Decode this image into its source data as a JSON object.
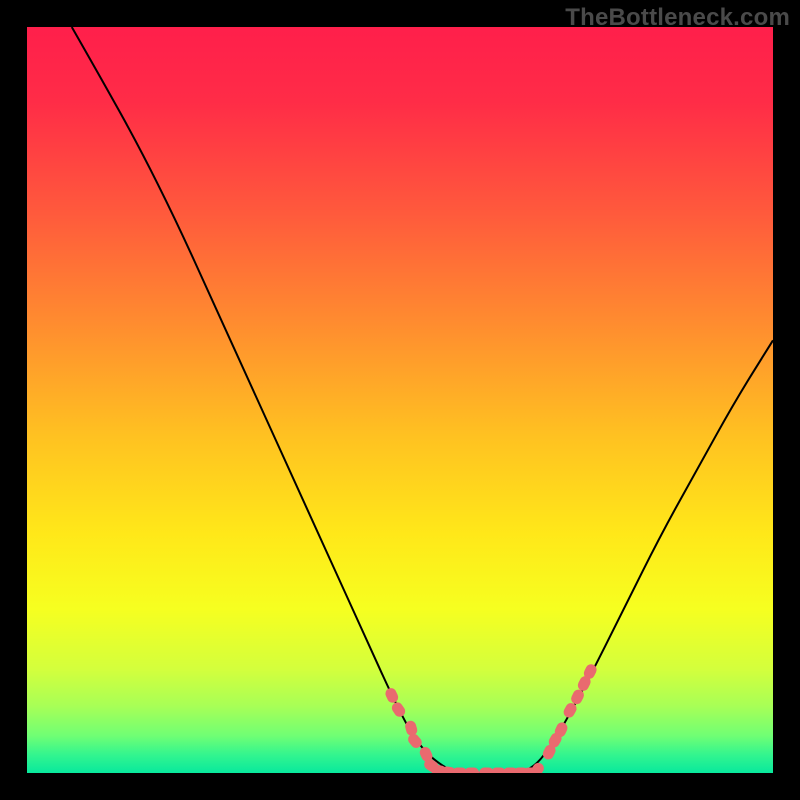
{
  "watermark": "TheBottleneck.com",
  "chart_data": {
    "type": "line",
    "title": "",
    "xlabel": "",
    "ylabel": "",
    "xlim": [
      0,
      100
    ],
    "ylim": [
      0,
      100
    ],
    "curve": {
      "name": "bottleneck-curve",
      "x": [
        6,
        10,
        15,
        20,
        25,
        30,
        35,
        40,
        45,
        50,
        53,
        57,
        60,
        63,
        67,
        70,
        75,
        80,
        85,
        90,
        95,
        100
      ],
      "y": [
        100,
        93,
        84,
        74,
        63,
        52,
        41,
        30,
        19,
        8,
        3,
        0,
        0,
        0,
        0,
        3,
        12,
        22,
        32,
        41,
        50,
        58
      ]
    },
    "marker_groups": [
      {
        "name": "left-cluster",
        "color": "#e96a6f",
        "points": [
          [
            48.9,
            10.4
          ],
          [
            49.8,
            8.5
          ],
          [
            51.5,
            6.0
          ],
          [
            52.0,
            4.3
          ],
          [
            53.5,
            2.5
          ],
          [
            54.2,
            1.0
          ],
          [
            55.2,
            0.3
          ],
          [
            56.5,
            0.1
          ]
        ]
      },
      {
        "name": "floor-cluster",
        "color": "#e96a6f",
        "points": [
          [
            56.5,
            0.0
          ],
          [
            58.0,
            0.0
          ],
          [
            59.6,
            0.0
          ],
          [
            61.6,
            0.0
          ],
          [
            63.2,
            0.0
          ],
          [
            64.8,
            0.0
          ],
          [
            66.2,
            0.0
          ],
          [
            67.5,
            0.0
          ]
        ]
      },
      {
        "name": "right-cluster",
        "color": "#e96a6f",
        "points": [
          [
            68.4,
            0.4
          ],
          [
            70.0,
            2.8
          ],
          [
            70.8,
            4.4
          ],
          [
            71.6,
            5.8
          ],
          [
            72.8,
            8.4
          ],
          [
            73.8,
            10.2
          ],
          [
            74.7,
            12.0
          ],
          [
            75.5,
            13.6
          ]
        ]
      }
    ],
    "gradient": {
      "stops": [
        {
          "offset": 0.0,
          "color": "#ff1f4b"
        },
        {
          "offset": 0.1,
          "color": "#ff2c47"
        },
        {
          "offset": 0.25,
          "color": "#ff5a3c"
        },
        {
          "offset": 0.4,
          "color": "#ff8d2f"
        },
        {
          "offset": 0.55,
          "color": "#ffc221"
        },
        {
          "offset": 0.68,
          "color": "#ffe819"
        },
        {
          "offset": 0.78,
          "color": "#f6ff20"
        },
        {
          "offset": 0.86,
          "color": "#d4ff3c"
        },
        {
          "offset": 0.91,
          "color": "#a8ff56"
        },
        {
          "offset": 0.95,
          "color": "#70ff74"
        },
        {
          "offset": 0.975,
          "color": "#34f58e"
        },
        {
          "offset": 1.0,
          "color": "#08e99d"
        }
      ]
    }
  }
}
